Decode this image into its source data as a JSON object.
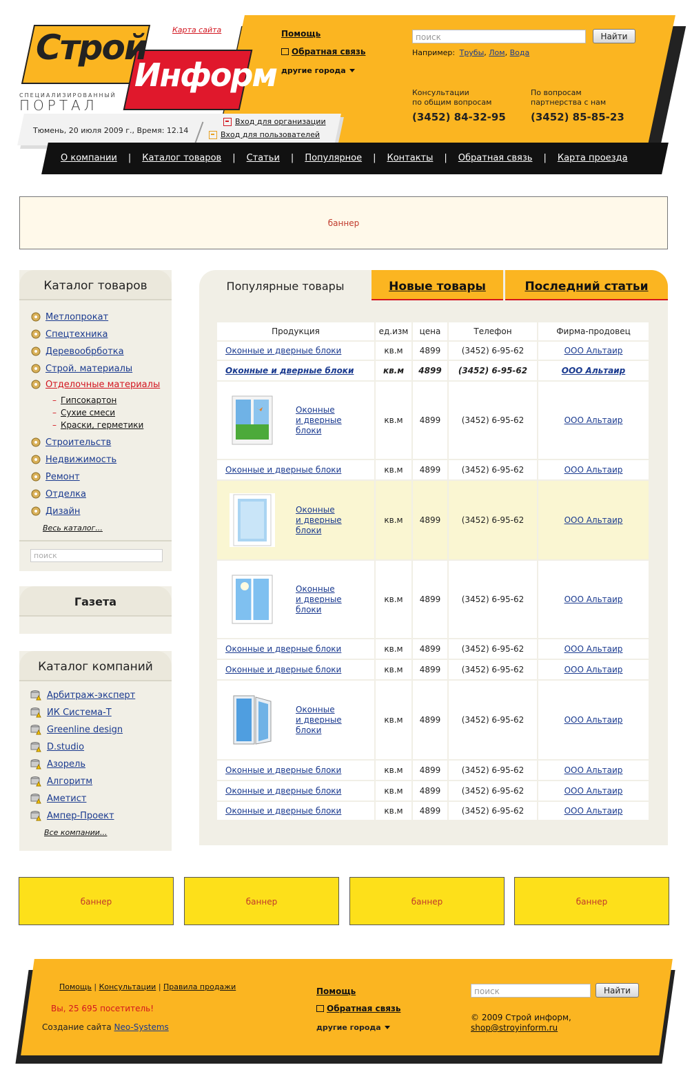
{
  "header": {
    "logo_line1": "Строй",
    "logo_line2": "Информ",
    "logo_sub1": "СПЕЦИАЛИЗИРОВАННЫЙ",
    "logo_sub2": "ПОРТАЛ",
    "sitemap": "Карта сайта",
    "help": "Помощь",
    "feedback": "Обратная связь",
    "other_cities": "другие города",
    "search_placeholder": "поиск",
    "search_button": "Найти",
    "example_label": "Например:",
    "examples": [
      "Трубы",
      "Лом",
      "Вода"
    ],
    "consult_label1": "Консультации",
    "consult_label2": "по общим вопросам",
    "consult_phone": "(3452) 84-32-95",
    "partner_label1": "По вопросам",
    "partner_label2": "партнерства с нам",
    "partner_phone": "(3452) 85-85-23",
    "date_text": "Тюмень, 20 июля 2009 г.,  Время: 12.14",
    "login_org": "Вход для организации",
    "login_user": "Вход для пользователей"
  },
  "menu": [
    "О компании",
    "Каталог товаров",
    "Статьи",
    "Популярное",
    "Контакты",
    "Обратная связь",
    "Карта проезда"
  ],
  "banner_top": "баннер",
  "catalog": {
    "title": "Каталог товаров",
    "items": [
      "Метлопрокат",
      "Спецтехника",
      "Деревообрботка",
      "Строй. материалы",
      "Отделочные материалы"
    ],
    "subitems": [
      "Гипсокартон",
      "Сухие смеси",
      "Краски, герметики"
    ],
    "items2": [
      "Строительств",
      "Недвижимость",
      "Ремонт",
      "Отделка",
      "Дизайн"
    ],
    "all": "Весь каталог...",
    "search_placeholder": "поиск"
  },
  "gazeta": {
    "title": "Газета"
  },
  "companies": {
    "title": "Каталог компаний",
    "items": [
      "Арбитраж-эксперт",
      "ИК Система-Т",
      "Greenline design",
      "D.studio",
      "Азорель",
      "Алгоритм",
      "Аметист",
      "Ампер-Проект"
    ],
    "all": "Все компании..."
  },
  "tabs": {
    "active": "Популярные товары",
    "new": "Новые товары",
    "articles": "Последний статьи"
  },
  "table": {
    "headers": [
      "Продукция",
      "ед.изм",
      "цена",
      "Телефон",
      "Фирма-продовец"
    ],
    "product": "Оконные и дверные блоки",
    "product_l1": "Оконные",
    "product_l2": "и дверные",
    "product_l3": "блоки",
    "unit": "кв.м",
    "price": "4899",
    "phone": "(3452) 6-95-62",
    "firm": "ООО Альтаир"
  },
  "bottom_banners": [
    "баннер",
    "баннер",
    "баннер",
    "баннер"
  ],
  "footer": {
    "link1": "Помощь",
    "link2": "Консультации",
    "link3": "Правила продажи",
    "visitors": "Вы, 25 695 посетитель!",
    "created_label": "Создание сайта",
    "created_link": "Neo-Systems",
    "help": "Помощь",
    "feedback": "Обратная связь",
    "other_cities": "другие города",
    "search_placeholder": "поиск",
    "search_button": "Найти",
    "copyright": "© 2009 Строй информ,",
    "email": "shop@stroyinform.ru"
  },
  "colors": {
    "accent": "#fbb521",
    "red": "#e0182c",
    "dark": "#111111",
    "panel": "#f1efe6"
  }
}
